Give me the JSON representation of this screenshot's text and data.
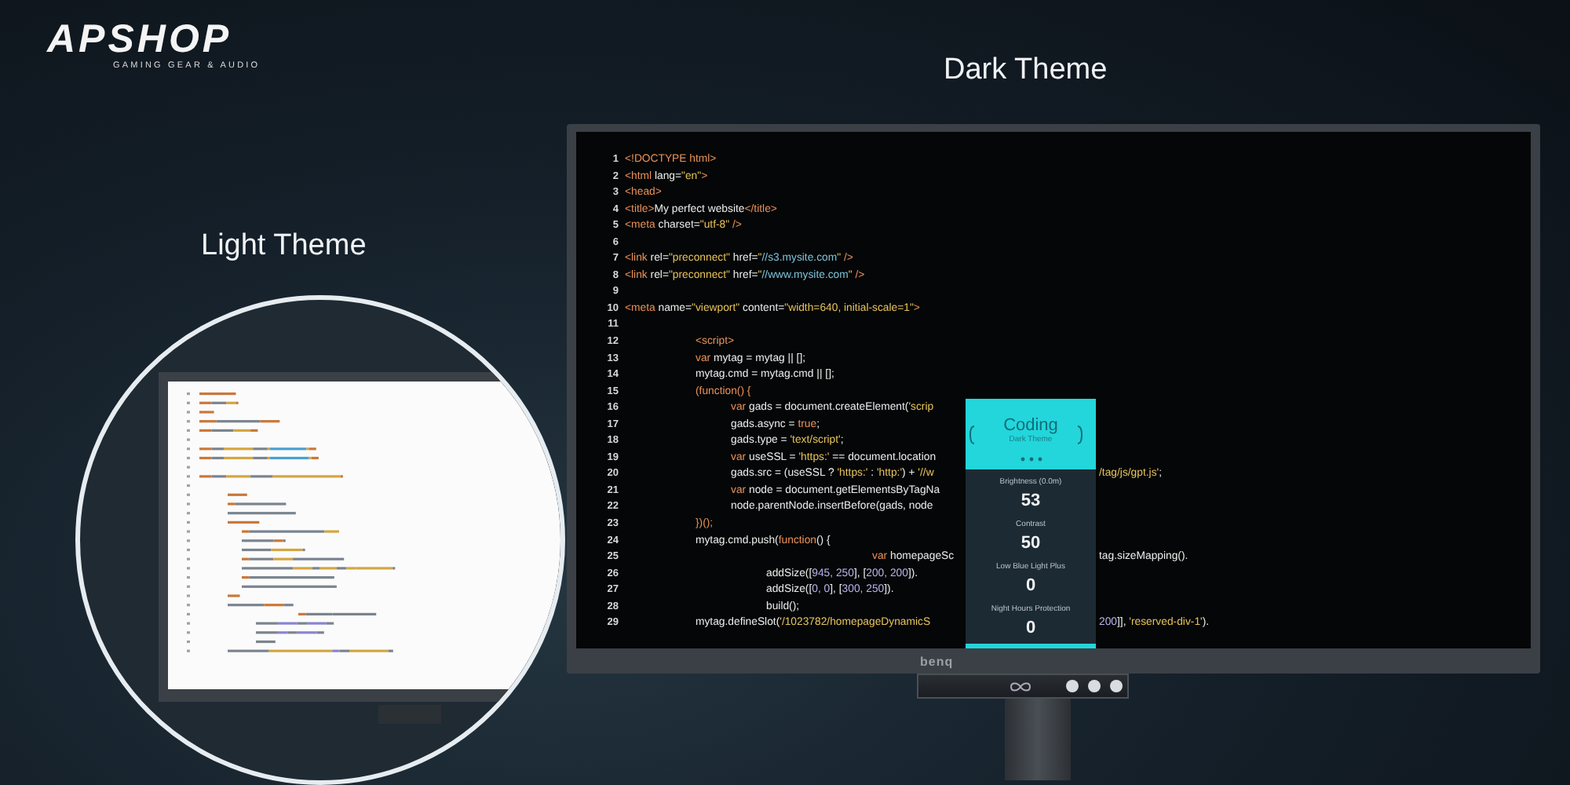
{
  "logo": {
    "wordmark": "APSHOP",
    "tagline": "GAMING GEAR & AUDIO"
  },
  "light_theme": {
    "heading": "Light Theme"
  },
  "dark_theme": {
    "heading": "Dark Theme",
    "code_lines": [
      {
        "number": "1",
        "segments": [
          {
            "kind": "tag",
            "text": "<!DOCTYPE html>"
          }
        ]
      },
      {
        "number": "2",
        "segments": [
          {
            "kind": "tag",
            "text": "<html"
          },
          {
            "kind": "text",
            "text": " lang="
          },
          {
            "kind": "string",
            "text": "\"en\""
          },
          {
            "kind": "tag",
            "text": ">"
          }
        ]
      },
      {
        "number": "3",
        "segments": [
          {
            "kind": "tag",
            "text": "<head>"
          }
        ]
      },
      {
        "number": "4",
        "segments": [
          {
            "kind": "tag",
            "text": "<title>"
          },
          {
            "kind": "text",
            "text": "My perfect website"
          },
          {
            "kind": "tag",
            "text": "</title>"
          }
        ]
      },
      {
        "number": "5",
        "segments": [
          {
            "kind": "tag",
            "text": "<meta"
          },
          {
            "kind": "text",
            "text": " charset="
          },
          {
            "kind": "string",
            "text": "\"utf-8\""
          },
          {
            "kind": "tag",
            "text": " />"
          }
        ]
      },
      {
        "number": "6"
      },
      {
        "number": "7",
        "segments": [
          {
            "kind": "tag",
            "text": "<link"
          },
          {
            "kind": "text",
            "text": " rel="
          },
          {
            "kind": "string",
            "text": "\"preconnect\""
          },
          {
            "kind": "text",
            "text": " href="
          },
          {
            "kind": "string",
            "text": "\""
          },
          {
            "kind": "link",
            "text": "//s3.mysite.com"
          },
          {
            "kind": "string",
            "text": "\""
          },
          {
            "kind": "tag",
            "text": " />"
          }
        ]
      },
      {
        "number": "8",
        "segments": [
          {
            "kind": "tag",
            "text": "<link"
          },
          {
            "kind": "text",
            "text": " rel="
          },
          {
            "kind": "string",
            "text": "\"preconnect\""
          },
          {
            "kind": "text",
            "text": " href="
          },
          {
            "kind": "string",
            "text": "\""
          },
          {
            "kind": "link",
            "text": "//www.mysite.com"
          },
          {
            "kind": "string",
            "text": "\""
          },
          {
            "kind": "tag",
            "text": " />"
          }
        ]
      },
      {
        "number": "9"
      },
      {
        "number": "10",
        "segments": [
          {
            "kind": "tag",
            "text": "<meta"
          },
          {
            "kind": "text",
            "text": " name="
          },
          {
            "kind": "string",
            "text": "\"viewport\""
          },
          {
            "kind": "text",
            "text": " content="
          },
          {
            "kind": "string",
            "text": "\"width=640, initial-scale=1\""
          },
          {
            "kind": "tag",
            "text": ">"
          }
        ]
      },
      {
        "number": "11"
      },
      {
        "number": "12",
        "segments": [
          {
            "kind": "tag",
            "text": "\t\t<script>"
          }
        ]
      },
      {
        "number": "13",
        "segments": [
          {
            "kind": "keyword",
            "text": "\t\tvar"
          },
          {
            "kind": "text",
            "text": " mytag = mytag || [];"
          }
        ]
      },
      {
        "number": "14",
        "segments": [
          {
            "kind": "text",
            "text": "\t\tmytag.cmd = mytag.cmd || [];"
          }
        ]
      },
      {
        "number": "15",
        "segments": [
          {
            "kind": "keyword",
            "text": "\t\t(function() {"
          }
        ]
      },
      {
        "number": "16",
        "segments": [
          {
            "kind": "keyword",
            "text": "\t\t\tvar"
          },
          {
            "kind": "text",
            "text": " gads = document.createElement("
          },
          {
            "kind": "string",
            "text": "'scrip"
          }
        ]
      },
      {
        "number": "17",
        "segments": [
          {
            "kind": "text",
            "text": "\t\t\tgads.async = "
          },
          {
            "kind": "keyword",
            "text": "true"
          },
          {
            "kind": "text",
            "text": ";"
          }
        ]
      },
      {
        "number": "18",
        "segments": [
          {
            "kind": "text",
            "text": "\t\t\tgads.type = "
          },
          {
            "kind": "string",
            "text": "'text/script'"
          },
          {
            "kind": "text",
            "text": ";"
          }
        ]
      },
      {
        "number": "19",
        "segments": [
          {
            "kind": "keyword",
            "text": "\t\t\tvar"
          },
          {
            "kind": "text",
            "text": " useSSL = "
          },
          {
            "kind": "string",
            "text": "'https:'"
          },
          {
            "kind": "text",
            "text": " == document.location"
          }
        ]
      },
      {
        "number": "20",
        "segments": [
          {
            "kind": "text",
            "text": "\t\t\tgads.src = (useSSL ? "
          },
          {
            "kind": "string",
            "text": "'https:'"
          },
          {
            "kind": "text",
            "text": " : "
          },
          {
            "kind": "string",
            "text": "'http:'"
          },
          {
            "kind": "text",
            "text": ") + "
          },
          {
            "kind": "string",
            "text": "'//w"
          }
        ],
        "right_segments": [
          {
            "kind": "string",
            "text": "/tag/js/gpt.js'"
          },
          {
            "kind": "text",
            "text": ";"
          }
        ]
      },
      {
        "number": "21",
        "segments": [
          {
            "kind": "keyword",
            "text": "\t\t\tvar"
          },
          {
            "kind": "text",
            "text": " node = document.getElementsByTagNa"
          }
        ]
      },
      {
        "number": "22",
        "segments": [
          {
            "kind": "text",
            "text": "\t\t\tnode.parentNode.insertBefore(gads, node"
          }
        ]
      },
      {
        "number": "23",
        "segments": [
          {
            "kind": "keyword",
            "text": "\t\t})();"
          }
        ]
      },
      {
        "number": "24",
        "segments": [
          {
            "kind": "text",
            "text": "\t\tmytag.cmd.push("
          },
          {
            "kind": "keyword",
            "text": "function"
          },
          {
            "kind": "text",
            "text": "() {"
          }
        ]
      },
      {
        "number": "25",
        "segments": [
          {
            "kind": "keyword",
            "text": "\t\t\t\t\t\t\tvar"
          },
          {
            "kind": "text",
            "text": " homepageSc"
          }
        ],
        "right_segments": [
          {
            "kind": "text",
            "text": "tag.sizeMapping()."
          }
        ]
      },
      {
        "number": "26",
        "segments": [
          {
            "kind": "text",
            "text": "\t\t\t\taddSize(["
          },
          {
            "kind": "number",
            "text": "945, 250"
          },
          {
            "kind": "text",
            "text": "], ["
          },
          {
            "kind": "number",
            "text": "200, 200"
          },
          {
            "kind": "text",
            "text": "])."
          }
        ]
      },
      {
        "number": "27",
        "segments": [
          {
            "kind": "text",
            "text": "\t\t\t\taddSize(["
          },
          {
            "kind": "number",
            "text": "0, 0"
          },
          {
            "kind": "text",
            "text": "], ["
          },
          {
            "kind": "number",
            "text": "300, 250"
          },
          {
            "kind": "text",
            "text": "])."
          }
        ]
      },
      {
        "number": "28",
        "segments": [
          {
            "kind": "text",
            "text": "\t\t\t\tbuild();"
          }
        ]
      },
      {
        "number": "29",
        "segments": [
          {
            "kind": "text",
            "text": "\t\tmytag.defineSlot("
          },
          {
            "kind": "string",
            "text": "'/1023782/homepageDynamicS"
          }
        ],
        "right_segments": [
          {
            "kind": "number",
            "text": "200"
          },
          {
            "kind": "text",
            "text": "]], "
          },
          {
            "kind": "string",
            "text": "'reserved-div-1'"
          },
          {
            "kind": "text",
            "text": ")."
          }
        ]
      }
    ],
    "osd": {
      "title": "Coding",
      "subtitle": "Dark Theme",
      "settings": [
        {
          "label": "Brightness (0.0m)",
          "value": "53"
        },
        {
          "label": "Contrast",
          "value": "50"
        },
        {
          "label": "Low Blue Light Plus",
          "value": "0"
        },
        {
          "label": "Night Hours Protection",
          "value": "0"
        }
      ]
    },
    "monitor": {
      "brand": "benq"
    }
  }
}
